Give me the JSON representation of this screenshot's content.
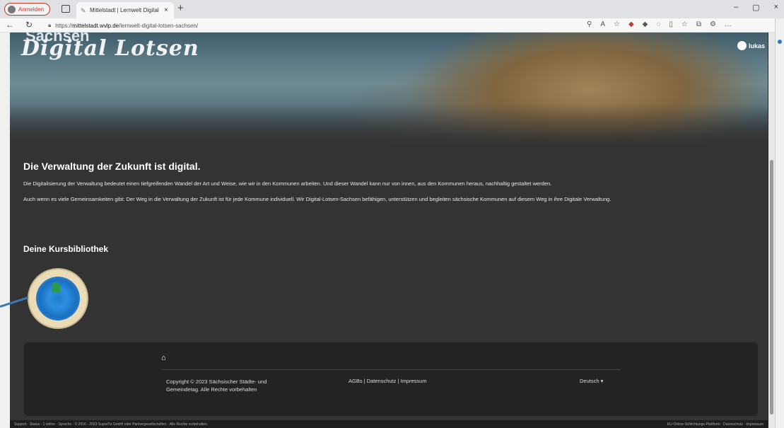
{
  "browser": {
    "profile_label": "Anmelden",
    "tab_title": "Mittelstadt | Lernwelt Digital Lotsen",
    "tab_close": "×",
    "new_tab": "+",
    "url_prefix": "https://",
    "url_host": "mittelstadt.wvlp.de",
    "url_path": "/lernwelt-digital-lotsen-sachsen/",
    "window_controls": [
      "–",
      "▢",
      "×"
    ]
  },
  "site": {
    "logo_top": "Sachsen",
    "logo_main": "Digital Lotsen",
    "user_name": "lukas"
  },
  "main": {
    "heading": "Die Verwaltung der Zukunft ist digital.",
    "paragraph1": "Die Digitalisierung der Verwaltung bedeutet einen tiefgreifenden Wandel der Art und Weise, wie wir in den Kommunen arbeiten. Und dieser Wandel kann nur von innen, aus den Kommunen heraus, nachhaltig gestaltet werden.",
    "paragraph2": "Auch wenn es viele Gemeinsamkeiten gibt: Der Weg in die Verwaltung der Zukunft ist für jede Kommune individuell. Wir Digital-Lotsen-Sachsen befähigen, unterstützen und begleiten sächsische Kommunen auf diesem Weg in ihre Digitale Verwaltung.",
    "library_heading": "Deine Kursbibliothek"
  },
  "footer": {
    "home_icon": "⌂",
    "copyright": "Copyright © 2023 Sächsischer Städte- und Gemeindetag. Alle Rechte vorbehalten",
    "links": "AGBs | Datenschutz | Impressum",
    "language": "Deutsch  ▾"
  },
  "statusbar": {
    "left": "Support · Status · 1 online · Sprache · © 2016 - 2023 SupraTix GmbH oder Partnergesellschaften - Alle Rechte vorbehalten.",
    "right": "EU-Online-Schlichtungs-Plattform · Datenschutz · Impressum"
  }
}
